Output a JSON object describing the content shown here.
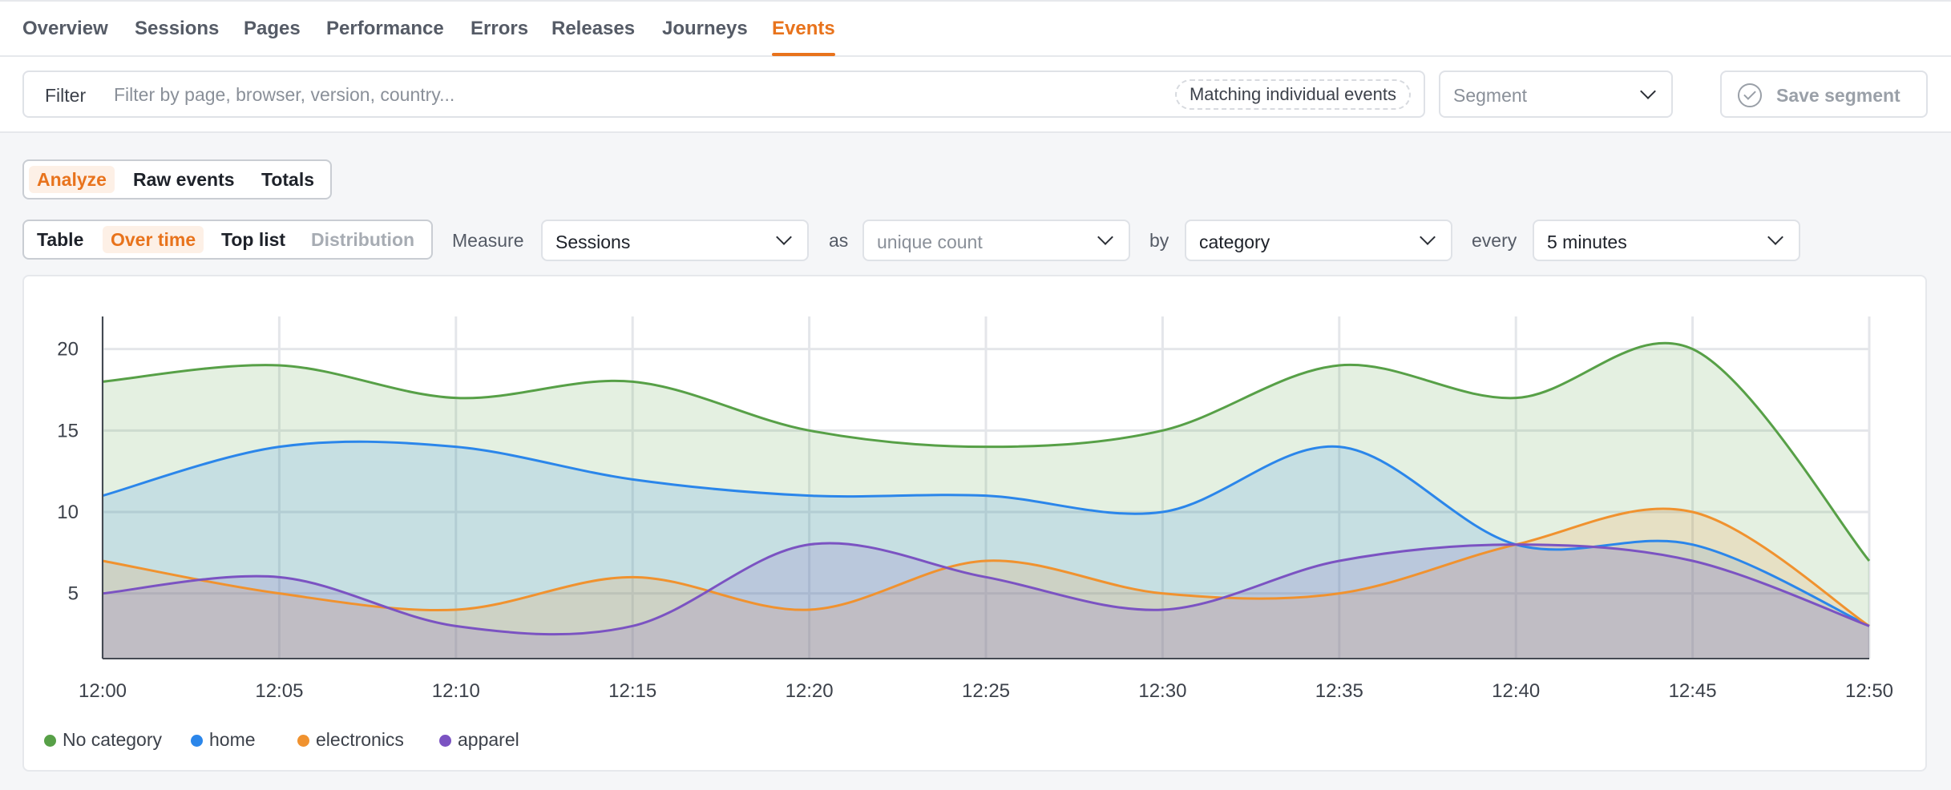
{
  "nav": {
    "tabs": [
      {
        "label": "Overview"
      },
      {
        "label": "Sessions"
      },
      {
        "label": "Pages"
      },
      {
        "label": "Performance"
      },
      {
        "label": "Errors"
      },
      {
        "label": "Releases"
      },
      {
        "label": "Journeys"
      },
      {
        "label": "Events",
        "active": true
      }
    ]
  },
  "filter": {
    "label": "Filter",
    "placeholder": "Filter by page, browser, version, country...",
    "badge": "Matching individual events"
  },
  "segment": {
    "placeholder": "Segment",
    "save_label": "Save segment"
  },
  "view_tabs": {
    "items": [
      "Analyze",
      "Raw events",
      "Totals"
    ],
    "active": "Analyze"
  },
  "chart_modes": {
    "items": [
      "Table",
      "Over time",
      "Top list",
      "Distribution"
    ],
    "active": "Over time",
    "disabled": "Distribution"
  },
  "query": {
    "measure_label": "Measure",
    "measure_value": "Sessions",
    "as_label": "as",
    "aggregate_placeholder": "unique count",
    "by_label": "by",
    "group_value": "category",
    "every_label": "every",
    "interval_value": "5 minutes"
  },
  "colors": {
    "accent": "#e8731c",
    "no_category": "#57a047",
    "home": "#2b86ea",
    "electronics": "#f0922f",
    "apparel": "#7b53c2"
  },
  "chart_data": {
    "type": "area",
    "x": [
      "12:00",
      "12:05",
      "12:10",
      "12:15",
      "12:20",
      "12:25",
      "12:30",
      "12:35",
      "12:40",
      "12:45",
      "12:50"
    ],
    "y_ticks": [
      5,
      10,
      15,
      20
    ],
    "ylim": [
      1,
      22
    ],
    "grid": true,
    "legend_position": "bottom-left",
    "series": [
      {
        "name": "No category",
        "color": "#57a047",
        "values": [
          18,
          19,
          17,
          18,
          15,
          14,
          15,
          19,
          17,
          20,
          7
        ]
      },
      {
        "name": "home",
        "color": "#2b86ea",
        "values": [
          11,
          14,
          14,
          12,
          11,
          11,
          10,
          14,
          8,
          8,
          3
        ]
      },
      {
        "name": "electronics",
        "color": "#f0922f",
        "values": [
          7,
          5,
          4,
          6,
          4,
          7,
          5,
          5,
          8,
          10,
          3
        ]
      },
      {
        "name": "apparel",
        "color": "#7b53c2",
        "values": [
          5,
          6,
          3,
          3,
          8,
          6,
          4,
          7,
          8,
          7,
          3
        ]
      }
    ]
  }
}
